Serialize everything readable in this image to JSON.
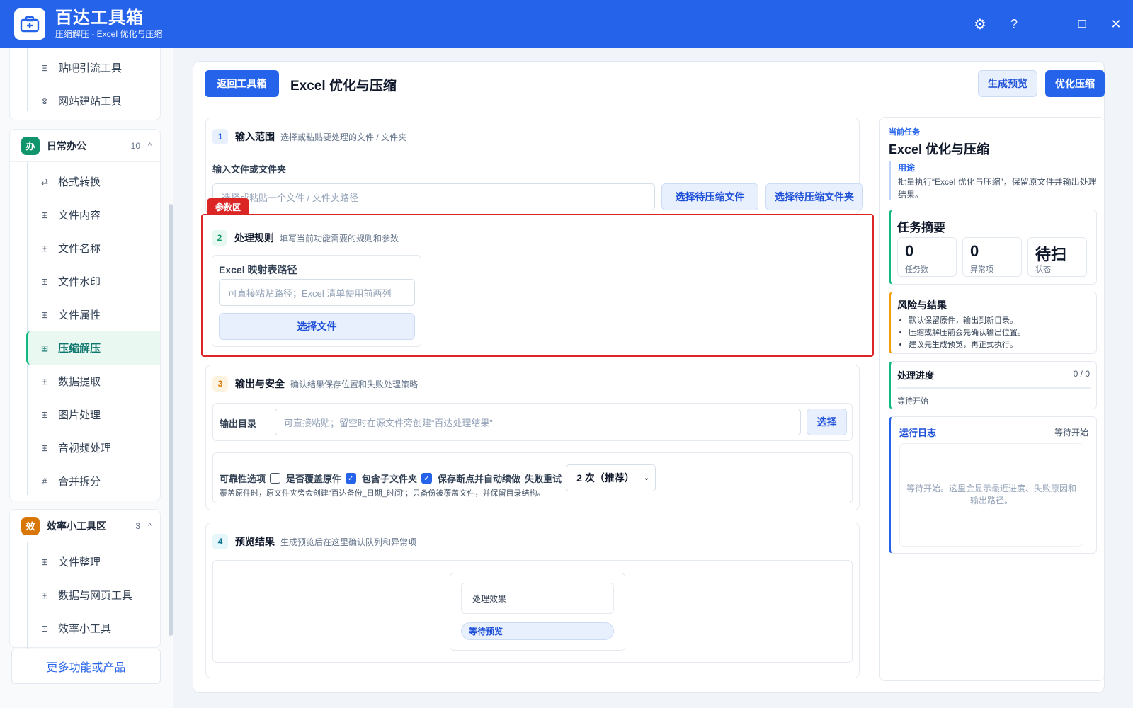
{
  "window": {
    "title": "百达工具箱",
    "subtitle": "压缩解压 - Excel 优化与压缩",
    "controls": {
      "settings": "⚙",
      "help": "?",
      "minimize": "–",
      "maximize": "☐",
      "close": "✕"
    }
  },
  "sidebar": {
    "top_items": [
      {
        "label": "贴吧引流工具",
        "icon": "⊟"
      },
      {
        "label": "网站建站工具",
        "icon": "⊗"
      }
    ],
    "office_group": {
      "badge": "办",
      "title": "日常办公",
      "count": "10",
      "caret": "^",
      "color": "#10946b",
      "items": [
        {
          "label": "格式转换",
          "icon": "⇄"
        },
        {
          "label": "文件内容",
          "icon": "⊞"
        },
        {
          "label": "文件名称",
          "icon": "⊞"
        },
        {
          "label": "文件水印",
          "icon": "⊞"
        },
        {
          "label": "文件属性",
          "icon": "⊞"
        },
        {
          "label": "压缩解压",
          "icon": "⊞",
          "active": true
        },
        {
          "label": "数据提取",
          "icon": "⊞"
        },
        {
          "label": "图片处理",
          "icon": "⊞"
        },
        {
          "label": "音视频处理",
          "icon": "⊞"
        },
        {
          "label": "合并拆分",
          "icon": "#"
        }
      ]
    },
    "efficiency_group": {
      "badge": "效",
      "title": "效率小工具区",
      "count": "3",
      "caret": "^",
      "color": "#d97706",
      "items": [
        {
          "label": "文件整理",
          "icon": "⊞"
        },
        {
          "label": "数据与网页工具",
          "icon": "⊞"
        },
        {
          "label": "效率小工具",
          "icon": "⊡"
        }
      ]
    },
    "more_label": "更多功能或产品"
  },
  "toolbar": {
    "back_label": "返回工具箱",
    "page_title": "Excel 优化与压缩",
    "preview_label": "生成预览",
    "run_label": "优化压缩"
  },
  "sections": {
    "input": {
      "num": "1",
      "title": "输入范围",
      "desc": "选择或粘贴要处理的文件 / 文件夹",
      "field_label": "输入文件或文件夹",
      "placeholder": "选择或粘贴一个文件 / 文件夹路径",
      "pick_file": "选择待压缩文件",
      "pick_folder": "选择待压缩文件夹"
    },
    "rules": {
      "tag": "参数区",
      "num": "2",
      "title": "处理规则",
      "desc": "填写当前功能需要的规则和参数",
      "card_title": "Excel 映射表路径",
      "placeholder": "可直接粘贴路径；Excel 清单使用前两列",
      "pick": "选择文件"
    },
    "output": {
      "num": "3",
      "title": "输出与安全",
      "desc": "确认结果保存位置和失败处理策略",
      "dir_label": "输出目录",
      "dir_placeholder": "可直接粘贴；留空时在源文件旁创建“百达处理结果”",
      "pick": "选择",
      "reliability_label": "可靠性选项",
      "opt_overwrite": "是否覆盖原件",
      "opt_overwrite_checked": false,
      "opt_subfolder": "包含子文件夹",
      "opt_subfolder_checked": true,
      "opt_resume": "保存断点并自动续做",
      "opt_resume_checked": true,
      "retry_label": "失败重试",
      "retry_value": "2 次（推荐）",
      "note": "覆盖原件时，原文件夹旁会创建“百达备份_日期_时间”；只备份被覆盖文件，并保留目录结构。"
    },
    "preview": {
      "num": "4",
      "title": "预览结果",
      "desc": "生成预览后在这里确认队列和异常项",
      "effect_label": "处理效果",
      "status": "等待预览"
    }
  },
  "task_panel": {
    "kicker": "当前任务",
    "title": "Excel 优化与压缩",
    "purpose_label": "用途",
    "purpose_text": "批量执行“Excel 优化与压缩”，保留原文件并输出处理结果。",
    "summary_title": "任务摘要",
    "stats": [
      {
        "value": "0",
        "key": "任务数"
      },
      {
        "value": "0",
        "key": "异常项"
      },
      {
        "value": "待扫",
        "key": "状态"
      }
    ],
    "risk_title": "风险与结果",
    "risks": [
      "默认保留原件，输出到新目录。",
      "压缩或解压前会先确认输出位置。",
      "建议先生成预览，再正式执行。"
    ],
    "progress_title": "处理进度",
    "progress_count": "0 / 0",
    "progress_fraction": 0,
    "progress_status": "等待开始",
    "log_title": "运行日志",
    "log_status": "等待开始",
    "log_placeholder": "等待开始。这里会显示最近进度、失败原因和输出路径。"
  },
  "colors": {
    "accent": "#2563eb",
    "success": "#10b981",
    "warning": "#f59e0b",
    "danger": "#dc2626"
  }
}
